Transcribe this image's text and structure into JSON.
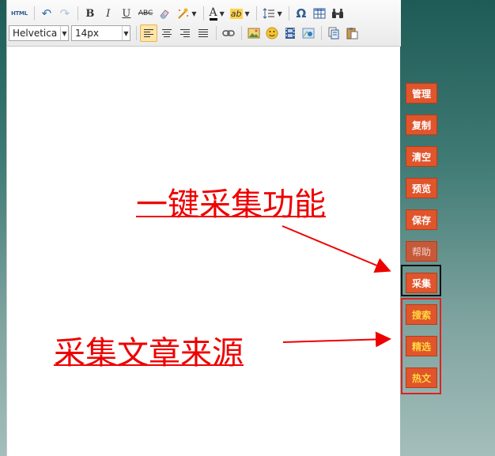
{
  "toolbar": {
    "row1": {
      "html": "HTML",
      "undo_icon": "undo-icon",
      "redo_icon": "redo-icon",
      "bold": "B",
      "italic": "I",
      "underline": "U",
      "strike": "ABC",
      "font_color": "A",
      "bg_color": "ab",
      "special_char": "Ω"
    },
    "row2": {
      "font_family": "Helvetica",
      "font_size": "14px"
    }
  },
  "side_buttons": {
    "manage": "管理",
    "copy": "复制",
    "clear": "清空",
    "preview": "预览",
    "save": "保存",
    "help": "帮助",
    "collect": "采集",
    "search": "搜索",
    "featured": "精选",
    "hot": "热文"
  },
  "annotations": {
    "one_click": "一键采集功能",
    "source": "采集文章来源"
  },
  "colors": {
    "button_bg": "#e0552c",
    "highlight_text": "#ffd93d",
    "annotation": "#e00000"
  }
}
